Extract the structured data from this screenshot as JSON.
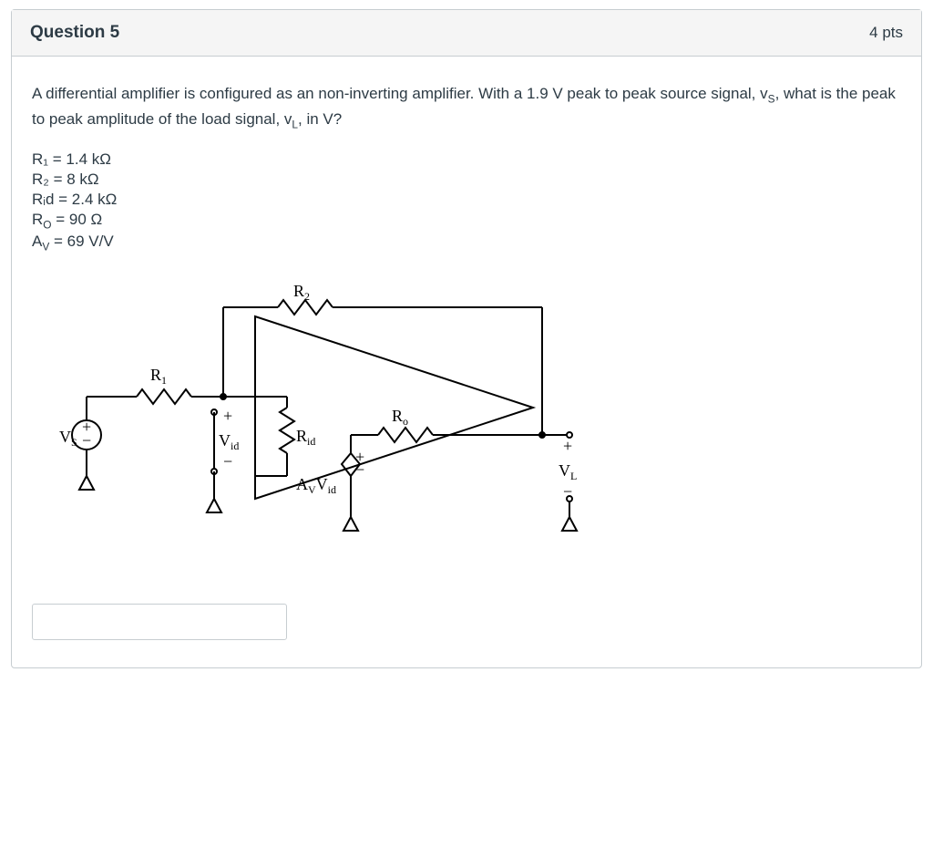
{
  "header": {
    "title": "Question 5",
    "points": "4 pts"
  },
  "prompt": "A differential amplifier is configured as an non-inverting amplifier. With a 1.9 V peak to peak source signal, v",
  "prompt_sub1": "S",
  "prompt_mid": ", what is the peak to peak amplitude of the load signal, v",
  "prompt_sub2": "L",
  "prompt_end": ", in V?",
  "params": {
    "r1": "R₁ = 1.4 kΩ",
    "r2": "R₂ = 8 kΩ",
    "rid": "Rᵢd = 2.4 kΩ",
    "ro": "R",
    "ro_sub": "O",
    "ro_rest": " = 90 Ω",
    "av": "A",
    "av_sub": "V",
    "av_rest": " = 69 V/V"
  },
  "circuit": {
    "vs": "V",
    "vs_sub": "S",
    "r1": "R",
    "r1_sub": "1",
    "r2": "R",
    "r2_sub": "2",
    "rid": "R",
    "rid_sub": "id",
    "ro": "R",
    "ro_sub": "o",
    "vid": "V",
    "vid_sub": "id",
    "avvid": "A",
    "avvid_sub1": "V",
    "avvid_mid": "V",
    "avvid_sub2": "id",
    "vl": "V",
    "vl_sub": "L",
    "plus": "+",
    "minus": "−"
  },
  "answer_placeholder": ""
}
